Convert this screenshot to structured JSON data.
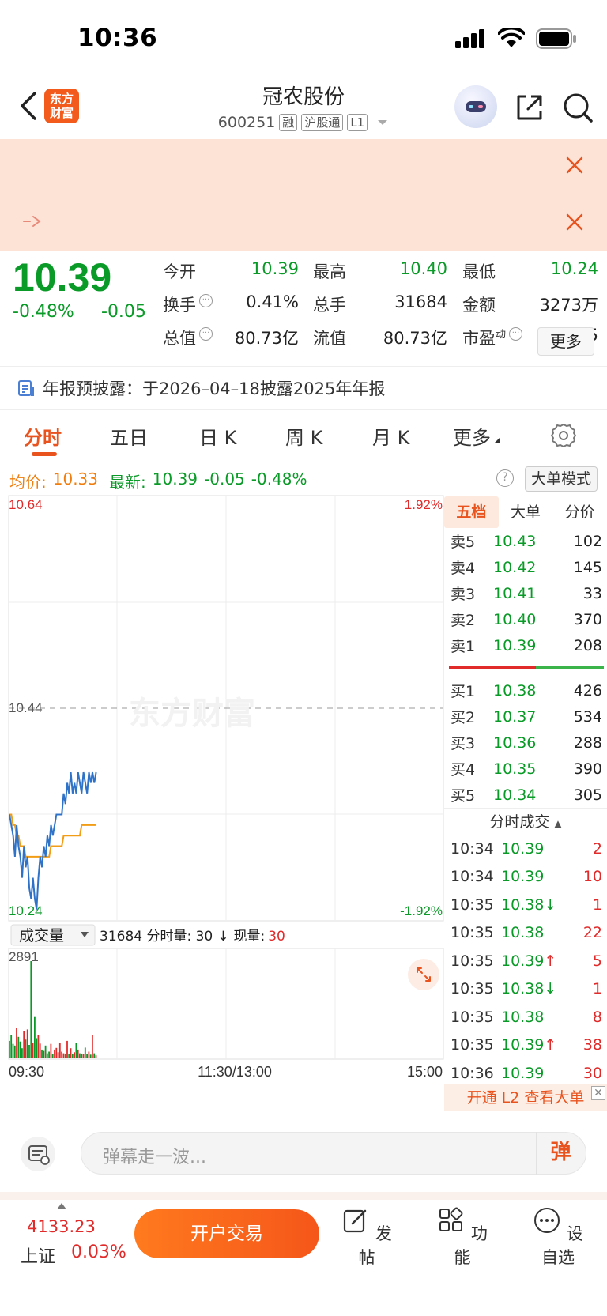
{
  "status_bar": {
    "time": "10:36"
  },
  "header": {
    "logo_text": "东方财富",
    "title": "冠农股份",
    "code": "600251",
    "tags": [
      "融",
      "沪股通",
      "L1"
    ]
  },
  "quote": {
    "price": "10.39",
    "change_pct": "-0.48%",
    "change": "-0.05",
    "fields": [
      {
        "label": "今开",
        "value": "10.39",
        "color": "#0a9a27"
      },
      {
        "label": "最高",
        "value": "10.40",
        "color": "#0a9a27"
      },
      {
        "label": "最低",
        "value": "10.24",
        "color": "#0a9a27"
      },
      {
        "label": "换手",
        "value": "0.41%",
        "color": "#222222"
      },
      {
        "label": "总手",
        "value": "31684",
        "color": "#222222"
      },
      {
        "label": "金额",
        "value": "3273万",
        "color": "#222222"
      },
      {
        "label": "总值",
        "value": "80.73亿",
        "color": "#222222"
      },
      {
        "label": "流值",
        "value": "80.73亿",
        "color": "#222222"
      },
      {
        "label": "市盈",
        "value": "17.45",
        "color": "#222222"
      }
    ],
    "pe_superscript": "动",
    "more_label": "更多"
  },
  "notice": {
    "text": "年报预披露：于2026–04–18披露2025年年报"
  },
  "tabs": [
    "分时",
    "五日",
    "日 K",
    "周 K",
    "月 K",
    "更多"
  ],
  "avg_line": {
    "avg_label": "均价:",
    "avg_value": "10.33",
    "latest_label": "最新:",
    "latest_value": "10.39",
    "latest_change": "-0.05",
    "latest_pct": "-0.48%"
  },
  "big_order_label": "大单模式",
  "chart_data": {
    "type": "line",
    "y_max": "10.64",
    "y_min": "10.24",
    "y_mid": "10.44",
    "pct_max": "1.92%",
    "pct_min": "-1.92%",
    "watermark": "东方财富",
    "x_labels": [
      "09:30",
      "11:30/13:00",
      "15:00"
    ],
    "ylim": [
      10.24,
      10.64
    ],
    "price_series": [
      10.34,
      10.33,
      10.32,
      10.3,
      10.33,
      10.31,
      10.3,
      10.28,
      10.31,
      10.29,
      10.3,
      10.27,
      10.26,
      10.28,
      10.26,
      10.25,
      10.28,
      10.3,
      10.29,
      10.31,
      10.3,
      10.32,
      10.31,
      10.33,
      10.32,
      10.33,
      10.34,
      10.34,
      10.34,
      10.34,
      10.36,
      10.35,
      10.37,
      10.36,
      10.38,
      10.36,
      10.37,
      10.36,
      10.38,
      10.37,
      10.36,
      10.38,
      10.37,
      10.36,
      10.38,
      10.37,
      10.38,
      10.37,
      10.38
    ],
    "avg_series": [
      10.34,
      10.34,
      10.33,
      10.33,
      10.32,
      10.32,
      10.31,
      10.31,
      10.31,
      10.3,
      10.3,
      10.3,
      10.3,
      10.3,
      10.3,
      10.3,
      10.3,
      10.3,
      10.3,
      10.3,
      10.3,
      10.3,
      10.3,
      10.31,
      10.31,
      10.31,
      10.31,
      10.31,
      10.31,
      10.31,
      10.32,
      10.32,
      10.32,
      10.32,
      10.32,
      10.32,
      10.32,
      10.32,
      10.32,
      10.32,
      10.33,
      10.33,
      10.33,
      10.33,
      10.33,
      10.33,
      10.33,
      10.33,
      10.33
    ],
    "volume_label": "成交量",
    "volume_summary": "31684 分时量: 30",
    "current_volume_label": "现量:",
    "current_volume": "30",
    "volume_max": "2891",
    "volume_series": [
      520,
      700,
      430,
      380,
      900,
      640,
      500,
      300,
      820,
      560,
      860,
      400,
      2891,
      470,
      1230,
      600,
      700,
      440,
      260,
      220,
      380,
      150,
      200,
      430,
      140,
      260,
      310,
      180,
      460,
      200,
      150,
      140,
      520,
      130,
      300,
      120,
      180,
      450,
      260,
      150,
      120,
      140,
      320,
      130,
      200,
      110,
      700,
      150,
      90
    ]
  },
  "order_book": {
    "tabs": [
      "五档",
      "大单",
      "分价"
    ],
    "asks": [
      {
        "label": "卖5",
        "price": "10.43",
        "vol": "102"
      },
      {
        "label": "卖4",
        "price": "10.42",
        "vol": "145"
      },
      {
        "label": "卖3",
        "price": "10.41",
        "vol": "33"
      },
      {
        "label": "卖2",
        "price": "10.40",
        "vol": "370"
      },
      {
        "label": "卖1",
        "price": "10.39",
        "vol": "208"
      }
    ],
    "bids": [
      {
        "label": "买1",
        "price": "10.38",
        "vol": "426"
      },
      {
        "label": "买2",
        "price": "10.37",
        "vol": "534"
      },
      {
        "label": "买3",
        "price": "10.36",
        "vol": "288"
      },
      {
        "label": "买4",
        "price": "10.35",
        "vol": "390"
      },
      {
        "label": "买5",
        "price": "10.34",
        "vol": "305"
      }
    ],
    "ticks_title": "分时成交",
    "ticks": [
      {
        "time": "10:34",
        "price": "10.39",
        "vol": "2"
      },
      {
        "time": "10:34",
        "price": "10.39",
        "vol": "10"
      },
      {
        "time": "10:35",
        "price": "10.38↓",
        "vol": "1"
      },
      {
        "time": "10:35",
        "price": "10.38",
        "vol": "22"
      },
      {
        "time": "10:35",
        "price": "10.39↑",
        "vol": "5"
      },
      {
        "time": "10:35",
        "price": "10.38↓",
        "vol": "1"
      },
      {
        "time": "10:35",
        "price": "10.38",
        "vol": "8"
      },
      {
        "time": "10:35",
        "price": "10.39↑",
        "vol": "38"
      },
      {
        "time": "10:36",
        "price": "10.39",
        "vol": "30"
      }
    ],
    "l2_banner": "开通 L2 查看大单"
  },
  "comment": {
    "placeholder": "弹幕走一波...",
    "danmu_label": "弹"
  },
  "bottom_bar": {
    "index_value": "4133.23",
    "index_name": "上证",
    "index_pct": "0.03%",
    "trade_label": "开户交易",
    "items": [
      "发帖",
      "功能",
      "设自选"
    ]
  }
}
